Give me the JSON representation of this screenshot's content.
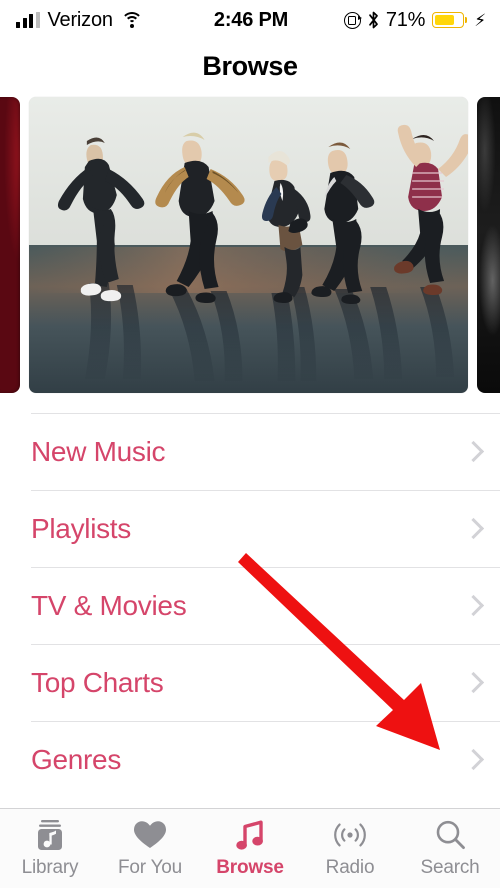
{
  "status_bar": {
    "signal_icon": "cellular-signal-icon",
    "carrier": "Verizon",
    "wifi_icon": "wifi-icon",
    "time": "2:46 PM",
    "rotation_lock_icon": "rotation-lock-icon",
    "bluetooth_icon": "bluetooth-icon",
    "battery_percent": "71%",
    "battery_level": 71,
    "battery_icon": "battery-icon",
    "charging_icon": "lightning-bolt-icon",
    "battery_color": "#ffd60a"
  },
  "nav": {
    "title": "Browse"
  },
  "carousel": {
    "left_peek_name": "previous-feature-card",
    "right_peek_name": "next-feature-card",
    "hero_name": "featured-artist-card",
    "hero_alt": "Five band members dancing against a white wall on a reflective dark floor"
  },
  "list": {
    "items": [
      {
        "label": "New Music",
        "icon": "chevron-right-icon"
      },
      {
        "label": "Playlists",
        "icon": "chevron-right-icon"
      },
      {
        "label": "TV & Movies",
        "icon": "chevron-right-icon"
      },
      {
        "label": "Top Charts",
        "icon": "chevron-right-icon"
      },
      {
        "label": "Genres",
        "icon": "chevron-right-icon"
      }
    ]
  },
  "annotation": {
    "name": "red-arrow-annotation",
    "color": "#ee1111",
    "points_to": "Genres row chevron"
  },
  "tab_bar": {
    "active": "Browse",
    "accent_color": "#d5456a",
    "inactive_color": "#8e8e93",
    "tabs": [
      {
        "label": "Library",
        "icon": "library-icon"
      },
      {
        "label": "For You",
        "icon": "heart-icon"
      },
      {
        "label": "Browse",
        "icon": "music-note-icon"
      },
      {
        "label": "Radio",
        "icon": "radio-waves-icon"
      },
      {
        "label": "Search",
        "icon": "search-icon"
      }
    ]
  }
}
